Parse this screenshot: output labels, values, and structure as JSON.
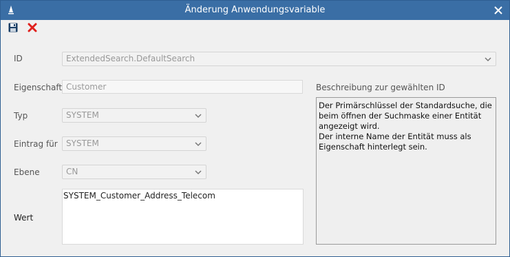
{
  "window": {
    "title": "Änderung Anwendungsvariable",
    "titlebar_color": "#3a6ea5"
  },
  "toolbar": {
    "save_icon": "save-icon",
    "cancel_icon": "cancel-icon"
  },
  "form": {
    "id_label": "ID",
    "id_value": "ExtendedSearch.DefaultSearch",
    "eigenschaft_label": "Eigenschaft",
    "eigenschaft_value": "Customer",
    "typ_label": "Typ",
    "typ_value": "SYSTEM",
    "eintrag_label": "Eintrag für",
    "eintrag_value": "SYSTEM",
    "ebene_label": "Ebene",
    "ebene_value": "CN",
    "wert_label": "Wert",
    "wert_value": "SYSTEM_Customer_Address_Telecom"
  },
  "description": {
    "label": "Beschreibung zur gewählten ID",
    "text": "Der Primärschlüssel der Standardsuche, die beim öffnen der Suchmaske einer Entität angezeigt wird.\nDer interne Name der Entität muss als Eigenschaft hinterlegt sein."
  }
}
